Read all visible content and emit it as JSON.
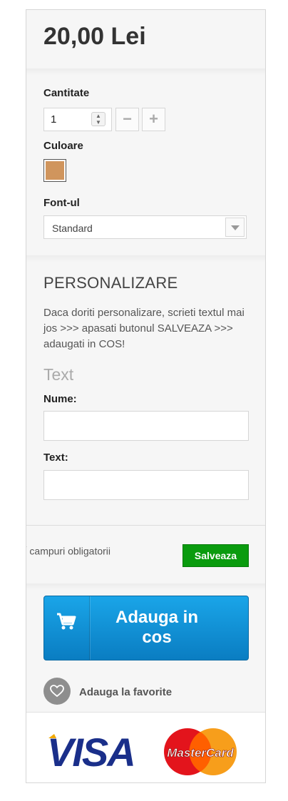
{
  "price": "20,00 Lei",
  "quantity": {
    "label": "Cantitate",
    "value": "1",
    "decrement_symbol": "−",
    "increment_symbol": "+"
  },
  "color": {
    "label": "Culoare",
    "swatch_hex": "#d0955d"
  },
  "font": {
    "label": "Font-ul",
    "selected": "Standard"
  },
  "personalization": {
    "heading": "PERSONALIZARE",
    "description": "Daca doriti personalizare, scrieti textul mai jos >>> apasati butonul SALVEAZA >>> adaugati in COS!",
    "text_heading": "Text",
    "name_label": "Nume:",
    "name_value": "",
    "text_label": "Text:",
    "text_value": ""
  },
  "required_note": {
    "star": "*",
    "text": " campuri obligatorii"
  },
  "save_label": "Salveaza",
  "add_to_cart_label": "Adauga in cos",
  "favorite_label": "Adauga la favorite",
  "payment": {
    "visa_text": "VISA",
    "mastercard_text": "MasterCard"
  },
  "colors": {
    "save_green": "#0a9b0e",
    "cart_blue": "#1190d6",
    "visa_blue": "#1a2f8a",
    "mc_red": "#e3141c",
    "mc_orange": "#f79e1b"
  }
}
